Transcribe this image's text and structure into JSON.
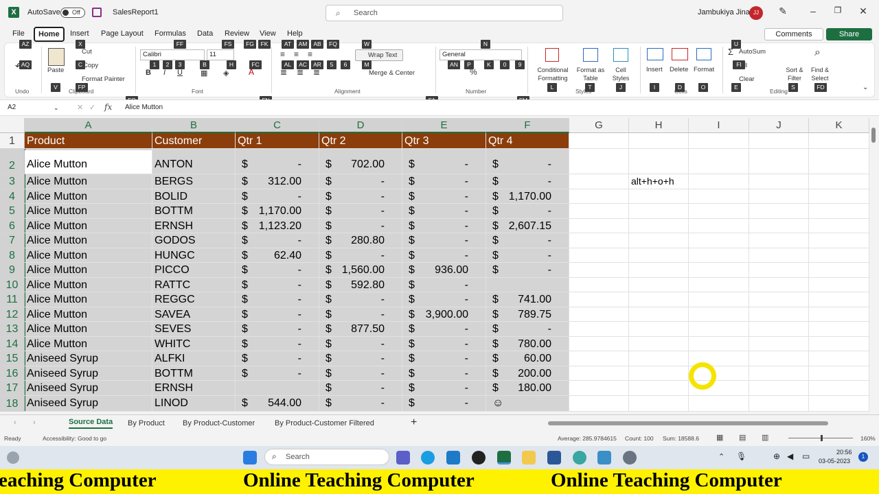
{
  "titlebar": {
    "autosave_label": "AutoSave",
    "autosave_state": "Off",
    "filename": "SalesReport1",
    "search_placeholder": "Search",
    "user_name": "Jambukiya Jinal",
    "user_initials": "JJ"
  },
  "menu": [
    "File",
    "Home",
    "Insert",
    "Page Layout",
    "Formulas",
    "Data",
    "Review",
    "View",
    "Help"
  ],
  "actions": {
    "comments": "Comments",
    "share": "Share"
  },
  "ribbon": {
    "clipboard": {
      "paste": "Paste",
      "cut": "Cut",
      "copy": "Copy",
      "format_painter": "Format Painter",
      "group": "Clipboard"
    },
    "undo_group": "Undo",
    "font": {
      "name": "Calibri",
      "size": "11",
      "group": "Font"
    },
    "alignment": {
      "wrap": "Wrap Text",
      "merge": "Merge & Center",
      "group": "Alignment"
    },
    "number": {
      "format": "General",
      "group": "Number"
    },
    "styles": {
      "conditional": "Conditional Formatting",
      "format_table": "Format as Table",
      "cell_styles": "Cell Styles",
      "group": "Styles"
    },
    "cells": {
      "insert": "Insert",
      "delete": "Delete",
      "format": "Format",
      "group": "Cells"
    },
    "editing": {
      "autosum": "AutoSum",
      "fill": "Fill",
      "clear": "Clear",
      "sort": "Sort & Filter",
      "find": "Find & Select",
      "group": "Editing"
    },
    "keytips": [
      "AZ",
      "X",
      "FF",
      "FS",
      "FG",
      "FK",
      "AT",
      "AM",
      "AB",
      "FQ",
      "W",
      "N",
      "U",
      "AQ",
      "C",
      "1",
      "2",
      "3",
      "B",
      "H",
      "FC",
      "AL",
      "AC",
      "AR",
      "5",
      "6",
      "M",
      "AN",
      "P",
      "K",
      "0",
      "9",
      "L",
      "T",
      "J",
      "I",
      "D",
      "O",
      "FI",
      "E",
      "S",
      "FD",
      "V",
      "FP",
      "FO",
      "FN",
      "FA",
      "FM"
    ]
  },
  "formula_bar": {
    "name_box": "A2",
    "fx": "fx",
    "content": "Alice Mutton"
  },
  "columns": [
    "A",
    "B",
    "C",
    "D",
    "E",
    "F",
    "G",
    "H",
    "I",
    "J",
    "K"
  ],
  "header_row": [
    "Product",
    "Customer",
    "Qtr 1",
    "Qtr 2",
    "Qtr 3",
    "Qtr 4"
  ],
  "rows": [
    [
      "2",
      "Alice Mutton",
      "ANTON",
      "-",
      "702.00",
      "-",
      "-"
    ],
    [
      "3",
      "Alice Mutton",
      "BERGS",
      "312.00",
      "-",
      "-",
      "-"
    ],
    [
      "4",
      "Alice Mutton",
      "BOLID",
      "-",
      "-",
      "-",
      "1,170.00"
    ],
    [
      "5",
      "Alice Mutton",
      "BOTTM",
      "1,170.00",
      "-",
      "-",
      "-"
    ],
    [
      "6",
      "Alice Mutton",
      "ERNSH",
      "1,123.20",
      "-",
      "-",
      "2,607.15"
    ],
    [
      "7",
      "Alice Mutton",
      "GODOS",
      "-",
      "280.80",
      "-",
      "-"
    ],
    [
      "8",
      "Alice Mutton",
      "HUNGC",
      "62.40",
      "-",
      "-",
      "-"
    ],
    [
      "9",
      "Alice Mutton",
      "PICCO",
      "-",
      "1,560.00",
      "936.00",
      "-"
    ],
    [
      "10",
      "Alice Mutton",
      "RATTC",
      "-",
      "592.80",
      "-",
      ""
    ],
    [
      "11",
      "Alice Mutton",
      "REGGC",
      "-",
      "-",
      "-",
      "741.00"
    ],
    [
      "12",
      "Alice Mutton",
      "SAVEA",
      "-",
      "-",
      "3,900.00",
      "789.75"
    ],
    [
      "13",
      "Alice Mutton",
      "SEVES",
      "-",
      "877.50",
      "-",
      "-"
    ],
    [
      "14",
      "Alice Mutton",
      "WHITC",
      "-",
      "-",
      "-",
      "780.00"
    ],
    [
      "15",
      "Aniseed Syrup",
      "ALFKI",
      "-",
      "-",
      "-",
      "60.00"
    ],
    [
      "16",
      "Aniseed Syrup",
      "BOTTM",
      "-",
      "-",
      "-",
      "200.00"
    ],
    [
      "17",
      "Aniseed Syrup",
      "ERNSH",
      "",
      "-",
      "-",
      "180.00"
    ],
    [
      "18",
      "Aniseed Syrup",
      "LINOD",
      "544.00",
      "-",
      "-",
      ""
    ]
  ],
  "note_cell": "alt+h+o+h",
  "sheet_tabs": [
    "Source Data",
    "By Product",
    "By Product-Customer",
    "By Product-Customer Filtered"
  ],
  "status": {
    "ready": "Ready",
    "accessibility": "Accessibility: Good to go",
    "average": "Average: 285.9784615",
    "count": "Count: 100",
    "sum": "Sum: 18588.6",
    "zoom": "160%"
  },
  "taskbar": {
    "search": "Search",
    "time": "20:56",
    "date": "03-05-2023"
  },
  "banner": [
    "eaching Computer",
    "Online Teaching Computer",
    "Online Teaching Computer"
  ]
}
